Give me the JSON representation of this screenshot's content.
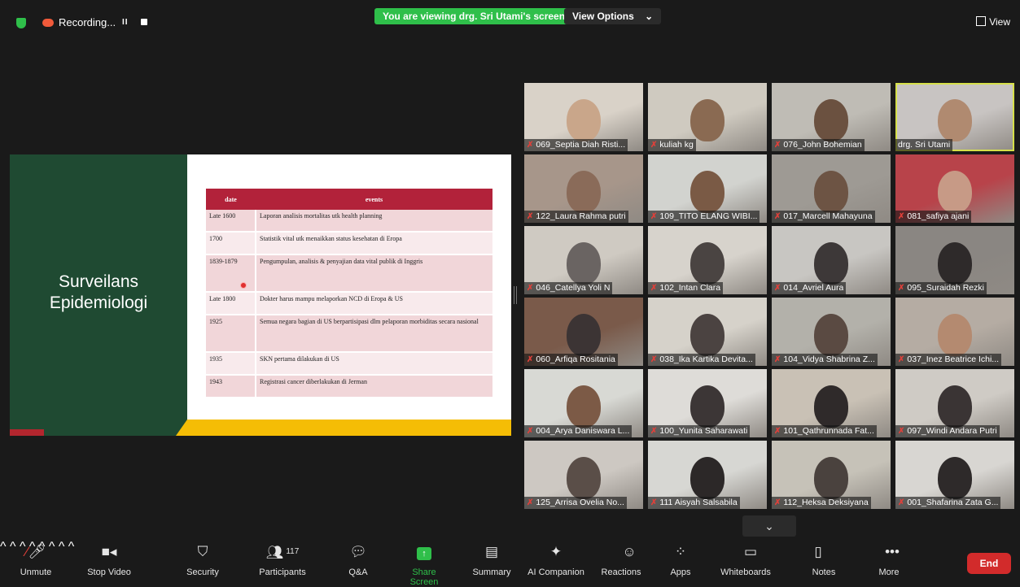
{
  "topbar": {
    "recording_label": "Recording...",
    "pause_label": "II",
    "share_banner": "You are viewing drg. Sri Utami's screen",
    "view_options_label": "View Options",
    "view_options_caret": "⌄",
    "view_label": "View"
  },
  "slide": {
    "title_line1": "Surveilans",
    "title_line2": "Epidemiologi",
    "table_headers": [
      "date",
      "events"
    ],
    "rows": [
      {
        "date": "Late 1600",
        "event": "Laporan analisis mortalitas utk health planning"
      },
      {
        "date": "1700",
        "event": "Statistik vital utk menaikkan status kesehatan di Eropa"
      },
      {
        "date": "1839-1879",
        "event": "Pengumpulan, analisis & penyajian data vital publik di Inggris"
      },
      {
        "date": "Late 1800",
        "event": "Dokter harus mampu melaporkan NCD di Eropa & US"
      },
      {
        "date": "1925",
        "event": "Semua negara bagian di US berpartisipasi dlm pelaporan morbiditas secara nasional"
      },
      {
        "date": "1935",
        "event": "SKN pertama dilakukan di US"
      },
      {
        "date": "1943",
        "event": "Registrasi cancer diberlakukan di Jerman"
      }
    ]
  },
  "participants": [
    {
      "name": "069_Septia Diah Risti...",
      "bg": "#d9d2c8",
      "face": "#c9a68a",
      "muted": true
    },
    {
      "name": "kuliah kg",
      "bg": "#cfcac0",
      "face": "#8a6a52",
      "muted": true
    },
    {
      "name": "076_John Bohemian",
      "bg": "#bfbcb5",
      "face": "#6b5140",
      "muted": true
    },
    {
      "name": "drg. Sri Utami",
      "bg": "#c8c4c2",
      "face": "#b08a70",
      "muted": false,
      "active": true
    },
    {
      "name": "122_Laura Rahma putri",
      "bg": "#a7968a",
      "face": "#8a6b59",
      "muted": true
    },
    {
      "name": "109_TITO ELANG WIBI...",
      "bg": "#d2d3cf",
      "face": "#7a5a45",
      "muted": true
    },
    {
      "name": "017_Marcell Mahayuna",
      "bg": "#9e9a94",
      "face": "#6d5444",
      "muted": true
    },
    {
      "name": "081_safiya ajani",
      "bg": "#b8434a",
      "face": "#c79a86",
      "muted": true
    },
    {
      "name": "046_Catellya Yoli N",
      "bg": "#cfcac2",
      "face": "#6a6462",
      "muted": true
    },
    {
      "name": "102_Intan Clara",
      "bg": "#d7d3cc",
      "face": "#4a4442",
      "muted": true
    },
    {
      "name": "014_Avriel Aura",
      "bg": "#c8c6c2",
      "face": "#3d3838",
      "muted": true
    },
    {
      "name": "095_Suraidah Rezki",
      "bg": "#8a8682",
      "face": "#2e2a2a",
      "muted": true
    },
    {
      "name": "060_Arfiqa Rositania",
      "bg": "#7a5a4a",
      "face": "#3c3434",
      "muted": true
    },
    {
      "name": "038_Ika Kartika Devita...",
      "bg": "#d6d2ca",
      "face": "#4b4341",
      "muted": true
    },
    {
      "name": "104_Vidya Shabrina Z...",
      "bg": "#b3b1aa",
      "face": "#5a4a42",
      "muted": true
    },
    {
      "name": "037_Inez Beatrice Ichi...",
      "bg": "#b5aca3",
      "face": "#b48a70",
      "muted": true
    },
    {
      "name": "004_Arya Daniswara L...",
      "bg": "#d8d9d4",
      "face": "#7c5a46",
      "muted": true
    },
    {
      "name": "100_Yunita Saharawati",
      "bg": "#dedcd8",
      "face": "#3c3636",
      "muted": true
    },
    {
      "name": "101_Qathrunnada Fat...",
      "bg": "#c9c1b5",
      "face": "#2f2a2a",
      "muted": true
    },
    {
      "name": "097_Windi Andara Putri",
      "bg": "#cfcbc5",
      "face": "#3a3434",
      "muted": true
    },
    {
      "name": "125_Arrisa Ovelia No...",
      "bg": "#cdc8c2",
      "face": "#5a4e48",
      "muted": true
    },
    {
      "name": "111 Aisyah Salsabila",
      "bg": "#d7d7d3",
      "face": "#2c2828",
      "muted": true
    },
    {
      "name": "112_Heksa Deksiyana",
      "bg": "#c6c2b8",
      "face": "#4a423e",
      "muted": true
    },
    {
      "name": "001_Shafarina Zata G...",
      "bg": "#d8d6d2",
      "face": "#2e2a2a",
      "muted": true
    }
  ],
  "scroll_glyph": "⌄",
  "toolbar": {
    "unmute": "Unmute",
    "stop_video": "Stop Video",
    "security": "Security",
    "participants": "Participants",
    "participants_count": "117",
    "qa": "Q&A",
    "share_screen": "Share Screen",
    "summary": "Summary",
    "ai_companion": "AI Companion",
    "reactions": "Reactions",
    "apps": "Apps",
    "whiteboards": "Whiteboards",
    "notes": "Notes",
    "more": "More",
    "end": "End"
  },
  "colors": {
    "share_green": "#2fbf4a",
    "slide_dark_green": "#1f4a32",
    "table_header_red": "#b2223a",
    "end_red": "#d22b2b",
    "active_speaker_outline": "#d6e04a"
  }
}
